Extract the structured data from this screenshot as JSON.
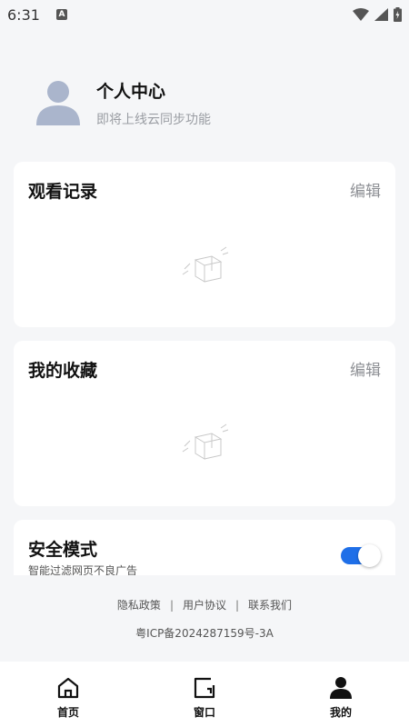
{
  "status_bar": {
    "time": "6:31",
    "badge": "A",
    "icons": [
      "wifi-icon",
      "signal-icon",
      "battery-charging-icon"
    ]
  },
  "profile": {
    "title": "个人中心",
    "subtitle": "即将上线云同步功能"
  },
  "history": {
    "title": "观看记录",
    "edit_label": "编辑"
  },
  "favorites": {
    "title": "我的收藏",
    "edit_label": "编辑"
  },
  "safe_mode": {
    "title": "安全模式",
    "subtitle": "智能过滤网页不良广告",
    "enabled": true,
    "toggle_color": "#1f6fe8"
  },
  "footer": {
    "privacy": "隐私政策",
    "sep1": "|",
    "agreement": "用户协议",
    "sep2": "|",
    "contact": "联系我们",
    "icp": "粤ICP备2024287159号-3A"
  },
  "nav": {
    "items": [
      {
        "label": "首页",
        "icon": "home-icon"
      },
      {
        "label": "窗口",
        "icon": "window-icon"
      },
      {
        "label": "我的",
        "icon": "profile-icon"
      }
    ],
    "active_index": 2
  }
}
